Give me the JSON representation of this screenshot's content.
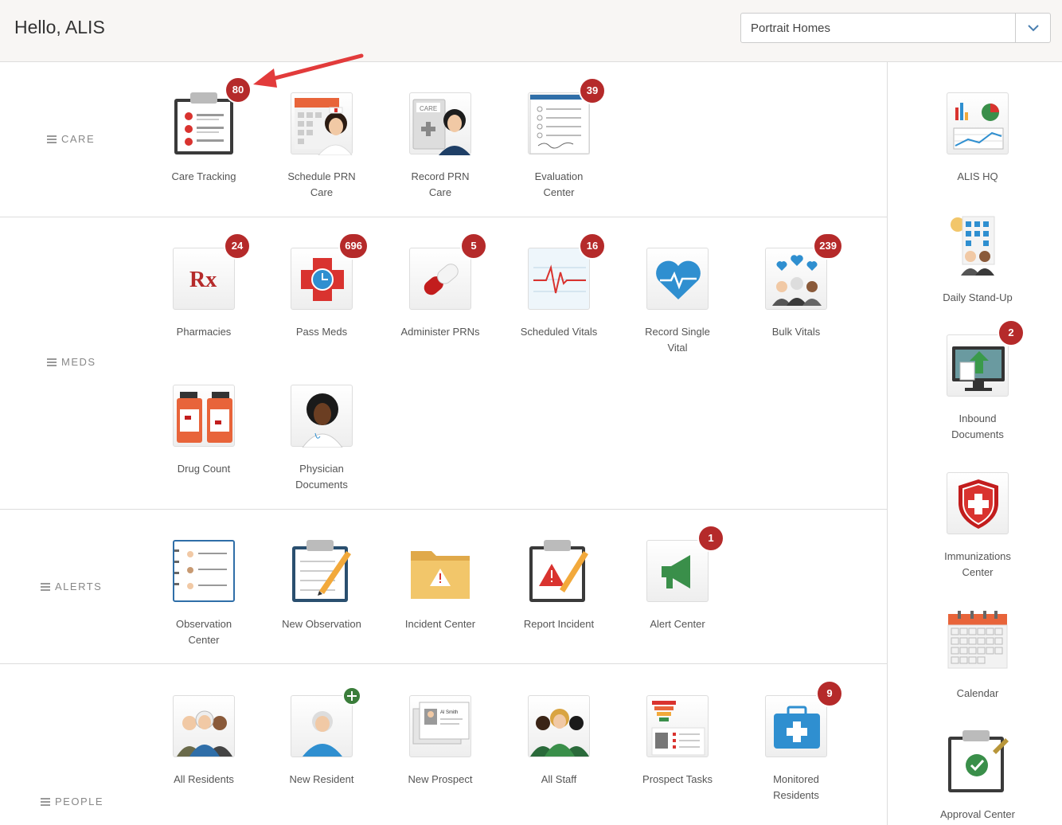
{
  "header": {
    "greeting": "Hello, ALIS",
    "org_value": "Portrait Homes"
  },
  "sections": {
    "care": "CARE",
    "meds": "MEDS",
    "alerts": "ALERTS",
    "people": "PEOPLE"
  },
  "tiles": {
    "care_tracking": {
      "l1": "Care Tracking",
      "badge": "80"
    },
    "schedule_prn": {
      "l1": "Schedule PRN",
      "l2": "Care"
    },
    "record_prn": {
      "l1": "Record PRN",
      "l2": "Care"
    },
    "evaluation": {
      "l1": "Evaluation",
      "l2": "Center",
      "badge": "39"
    },
    "pharmacies": {
      "l1": "Pharmacies",
      "badge": "24"
    },
    "pass_meds": {
      "l1": "Pass Meds",
      "badge": "696"
    },
    "administer_prns": {
      "l1": "Administer PRNs",
      "badge": "5"
    },
    "scheduled_vitals": {
      "l1": "Scheduled Vitals",
      "badge": "16"
    },
    "record_vital": {
      "l1": "Record Single",
      "l2": "Vital"
    },
    "bulk_vitals": {
      "l1": "Bulk Vitals",
      "badge": "239"
    },
    "drug_count": {
      "l1": "Drug Count"
    },
    "physician_docs": {
      "l1": "Physician",
      "l2": "Documents"
    },
    "observation_center": {
      "l1": "Observation",
      "l2": "Center"
    },
    "new_observation": {
      "l1": "New Observation"
    },
    "incident_center": {
      "l1": "Incident Center"
    },
    "report_incident": {
      "l1": "Report Incident"
    },
    "alert_center": {
      "l1": "Alert Center",
      "badge": "1"
    },
    "all_residents": {
      "l1": "All Residents"
    },
    "new_resident": {
      "l1": "New Resident"
    },
    "new_prospect": {
      "l1": "New Prospect"
    },
    "all_staff": {
      "l1": "All Staff"
    },
    "prospect_tasks": {
      "l1": "Prospect Tasks"
    },
    "monitored_residents": {
      "l1": "Monitored",
      "l2": "Residents",
      "badge": "9"
    }
  },
  "sidebar": {
    "alis_hq": {
      "l1": "ALIS HQ"
    },
    "daily_standup": {
      "l1": "Daily Stand-Up"
    },
    "inbound_docs": {
      "l1": "Inbound",
      "l2": "Documents",
      "badge": "2"
    },
    "immunizations": {
      "l1": "Immunizations",
      "l2": "Center"
    },
    "calendar": {
      "l1": "Calendar"
    },
    "approval_center": {
      "l1": "Approval Center"
    }
  },
  "icons": {
    "rx_text": "Rx",
    "card_name": "Al Smith",
    "care_chip": "CARE"
  },
  "colors": {
    "badge": "#b52a2a",
    "accent_red": "#d9332f",
    "accent_orange": "#e8643a",
    "accent_blue": "#2f8fd0"
  }
}
